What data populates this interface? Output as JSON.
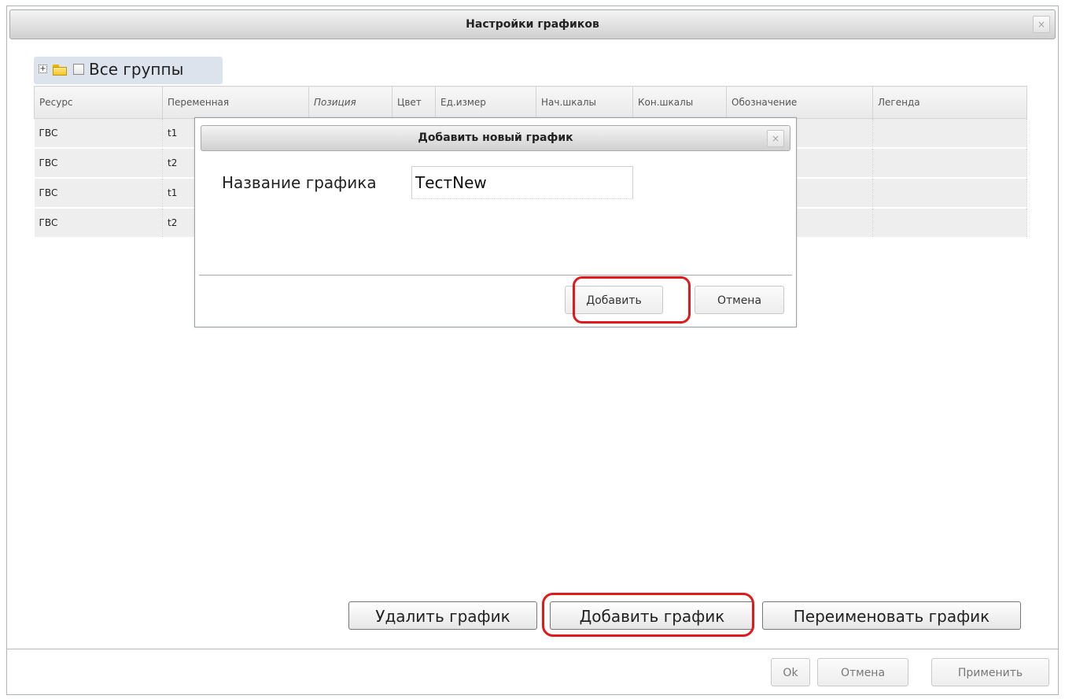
{
  "main_window": {
    "title": "Настройки графиков",
    "close_glyph": "×"
  },
  "tree": {
    "expander_glyph": "+",
    "label": "Все группы",
    "icon": "folder-icon"
  },
  "grid": {
    "columns": [
      "Ресурс",
      "Переменная",
      "Позиция",
      "Цвет",
      "Ед.измер",
      "Нач.шкалы",
      "Кон.шкалы",
      "Обозначение",
      "Легенда"
    ],
    "rows": [
      {
        "resource": "ГВС",
        "variable": "t1"
      },
      {
        "resource": "ГВС",
        "variable": "t2"
      },
      {
        "resource": "ГВС",
        "variable": "t1"
      },
      {
        "resource": "ГВС",
        "variable": "t2"
      }
    ]
  },
  "actions": {
    "delete_label": "Удалить график",
    "add_label": "Добавить график",
    "rename_label": "Переименовать график"
  },
  "footer": {
    "ok_label": "Ok",
    "cancel_label": "Отмена",
    "apply_label": "Применить"
  },
  "dialog": {
    "title": "Добавить новый график",
    "close_glyph": "×",
    "name_label": "Название графика",
    "name_value": "ТестNew",
    "add_label": "Добавить",
    "cancel_label": "Отмена"
  },
  "colors": {
    "highlight": "#e01a1a",
    "tree_row_bg": "#dde3ec",
    "grid_row_bg": "#eeeeee"
  }
}
